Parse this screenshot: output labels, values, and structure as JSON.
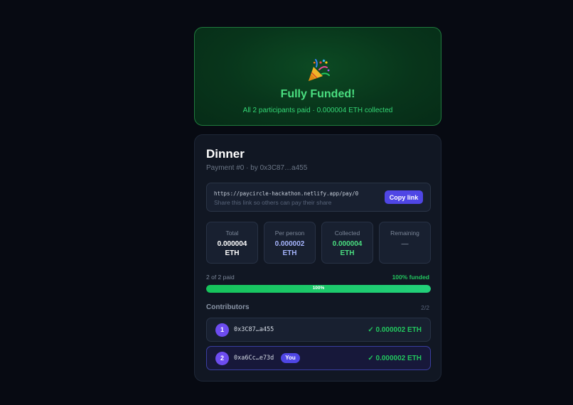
{
  "banner": {
    "icon": "party-popper-icon",
    "title": "Fully Funded!",
    "subtitle": "All 2 participants paid · 0.000004 ETH collected"
  },
  "payment": {
    "title": "Dinner",
    "meta": "Payment #0 · by 0x3C87…a455"
  },
  "share": {
    "url": "https://paycircle-hackathon.netlify.app/pay/0",
    "hint": "Share this link so others can pay their share",
    "copy_label": "Copy link"
  },
  "stats": [
    {
      "label": "Total",
      "value": "0.000004",
      "unit": "ETH",
      "color": "#ffffff"
    },
    {
      "label": "Per person",
      "value": "0.000002",
      "unit": "ETH",
      "color": "#a5b4fc"
    },
    {
      "label": "Collected",
      "value": "0.000004",
      "unit": "ETH",
      "color": "#4ade80"
    },
    {
      "label": "Remaining",
      "value": "—",
      "unit": "",
      "color": "#6b7686"
    }
  ],
  "progress": {
    "paid_text": "2 of 2 paid",
    "funded_text": "100% funded",
    "percent": 100,
    "bar_label": "100%"
  },
  "contributors": {
    "heading": "Contributors",
    "count": "2/2",
    "rows": [
      {
        "index": "1",
        "address": "0x3C87…a455",
        "amount": "✓ 0.000002 ETH",
        "is_you": false
      },
      {
        "index": "2",
        "address": "0xa6Cc…e73d",
        "amount": "✓ 0.000002 ETH",
        "is_you": true,
        "badge": "You"
      }
    ]
  },
  "colors": {
    "accent": "#4f46e5",
    "success": "#22c55e",
    "background": "#070a12",
    "card": "#111723"
  }
}
